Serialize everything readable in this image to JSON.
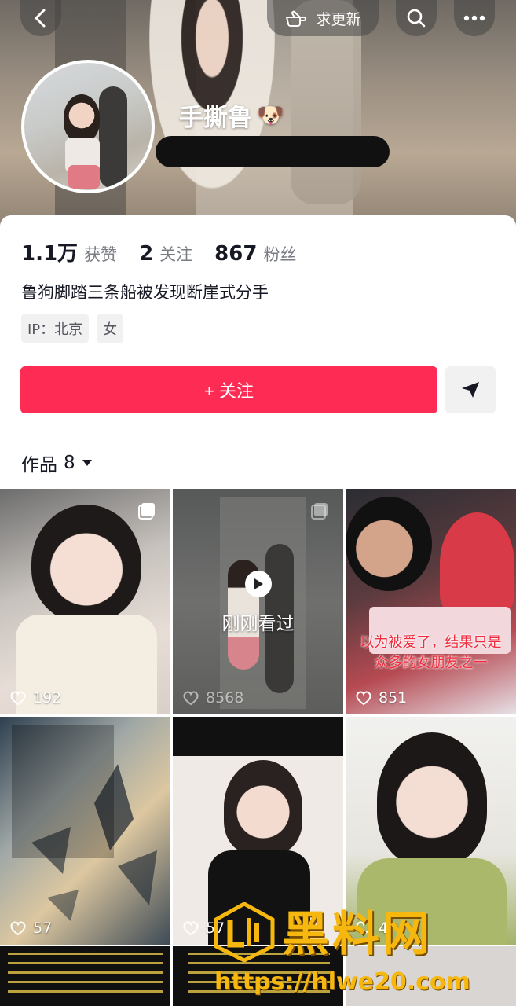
{
  "header": {
    "request_update_label": "求更新",
    "profile_name": "手撕鲁",
    "name_emoji": "🐶"
  },
  "stats": [
    {
      "num": "1.1万",
      "label": "获赞"
    },
    {
      "num": "2",
      "label": "关注"
    },
    {
      "num": "867",
      "label": "粉丝"
    }
  ],
  "bio": "鲁狗脚踏三条船被发现断崖式分手",
  "tags": [
    "IP：北京",
    "女"
  ],
  "follow_label": "+ 关注",
  "works": {
    "label": "作品",
    "count": "8"
  },
  "videos": [
    {
      "likes": "192"
    },
    {
      "likes": "8568",
      "overlay": "刚刚看过"
    },
    {
      "likes": "851",
      "caption": "以为被爱了，结果只是众多的女朋友之一"
    },
    {
      "likes": "57"
    },
    {
      "likes": "57"
    },
    {
      "likes": "4"
    }
  ],
  "watermark": {
    "brand": "黑料网",
    "url": "https://hlwe20.com"
  },
  "colors": {
    "accent": "#fe2c55",
    "text": "#161823",
    "muted": "#7a7c83"
  }
}
